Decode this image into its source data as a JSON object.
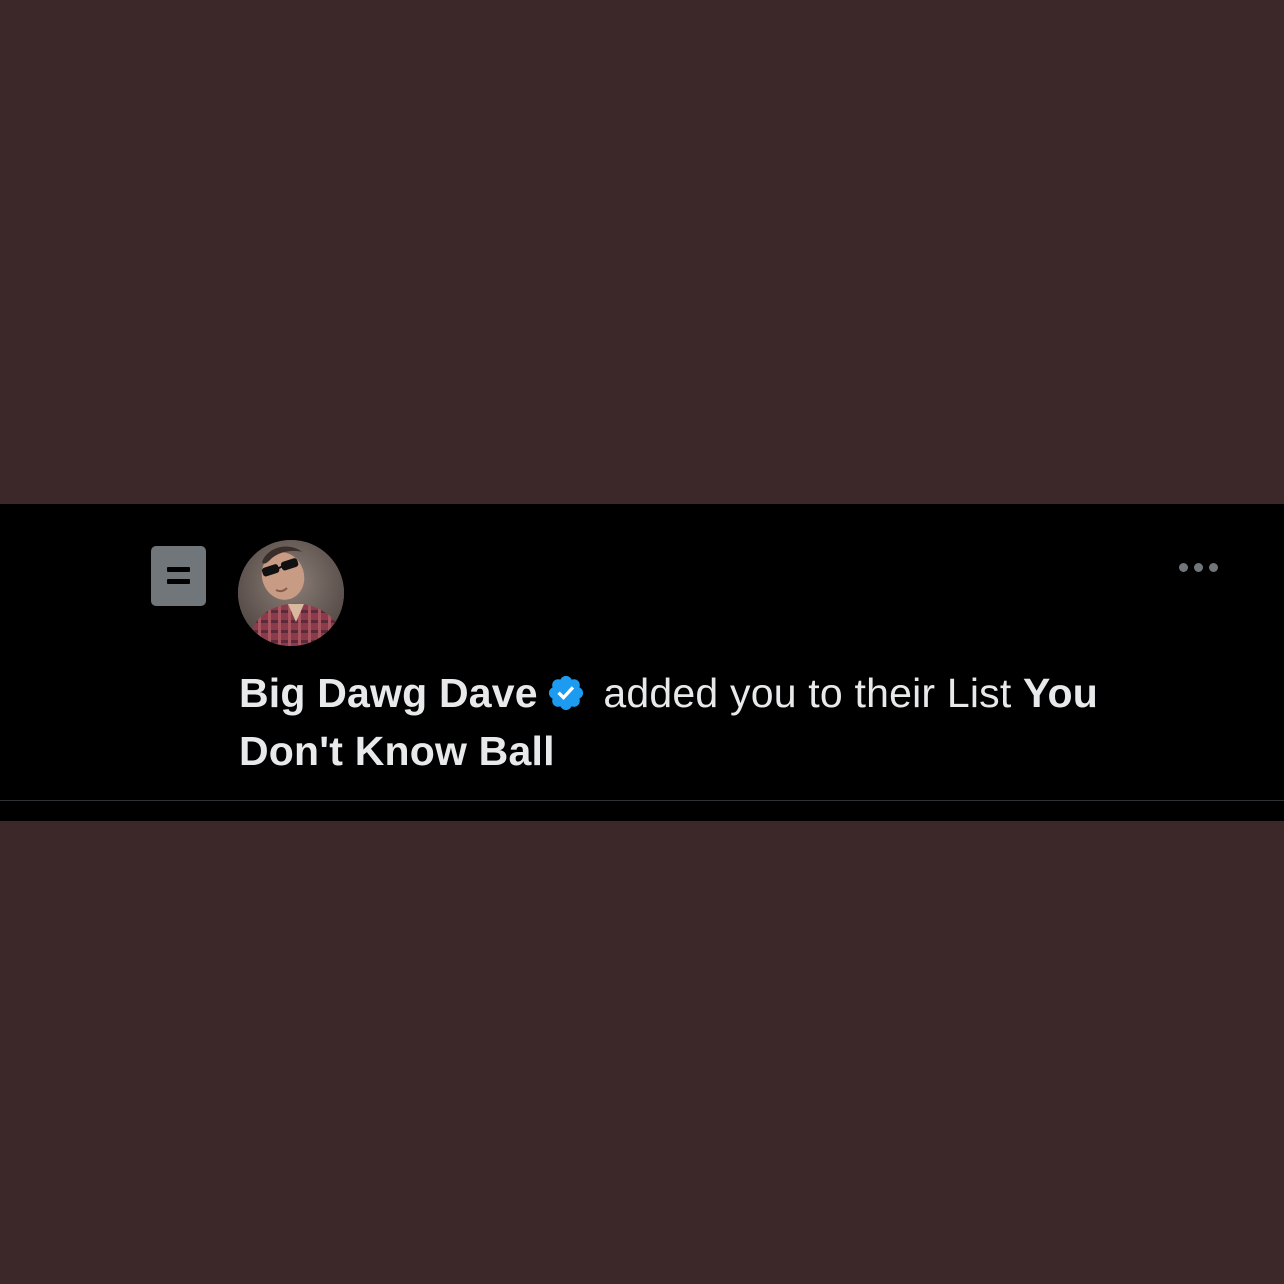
{
  "notification": {
    "actor_name": "Big Dawg Dave",
    "action_text": "added you to their List",
    "list_name": "You Don't Know Ball",
    "icons": {
      "type_icon": "list-icon",
      "verified_icon": "verified-badge-icon",
      "more_icon": "more-options-icon"
    }
  },
  "colors": {
    "backdrop": "#3c2828",
    "background": "#000000",
    "text": "#e7e9ea",
    "muted": "#71767b",
    "verified": "#1d9bf0"
  }
}
